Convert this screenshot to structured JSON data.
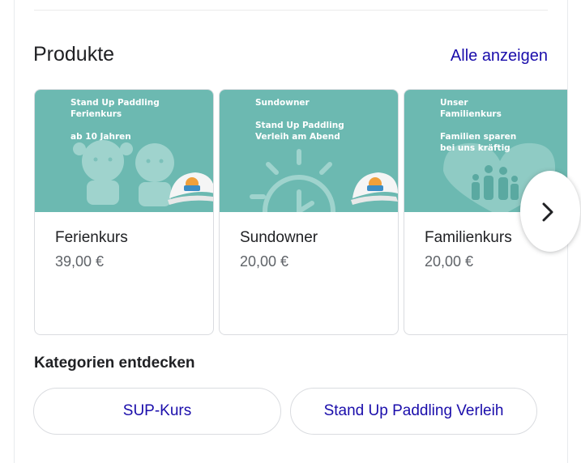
{
  "section": {
    "title": "Produkte",
    "see_all_label": "Alle anzeigen"
  },
  "products": [
    {
      "name": "Ferienkurs",
      "price": "39,00 €",
      "image_lines": [
        "Stand Up Paddling",
        "Ferienkurs",
        "ab 10 Jahren"
      ]
    },
    {
      "name": "Sundowner",
      "price": "20,00 €",
      "image_lines": [
        "Sundowner",
        "Stand Up Paddling",
        "Verleih am Abend"
      ]
    },
    {
      "name": "Familienkurs",
      "price": "20,00 €",
      "image_lines": [
        "Unser",
        "Familienkurs",
        "Familien sparen",
        "bei uns kräftig"
      ]
    }
  ],
  "categories": {
    "title": "Kategorien entdecken",
    "chips": [
      "SUP-Kurs",
      "Stand Up Paddling Verleih"
    ]
  },
  "icons": {
    "next": "chevron-right-icon",
    "product_badge": "cap-icon"
  },
  "colors": {
    "image_teal": "#6cb9b1",
    "link_blue": "#1a0dab"
  }
}
